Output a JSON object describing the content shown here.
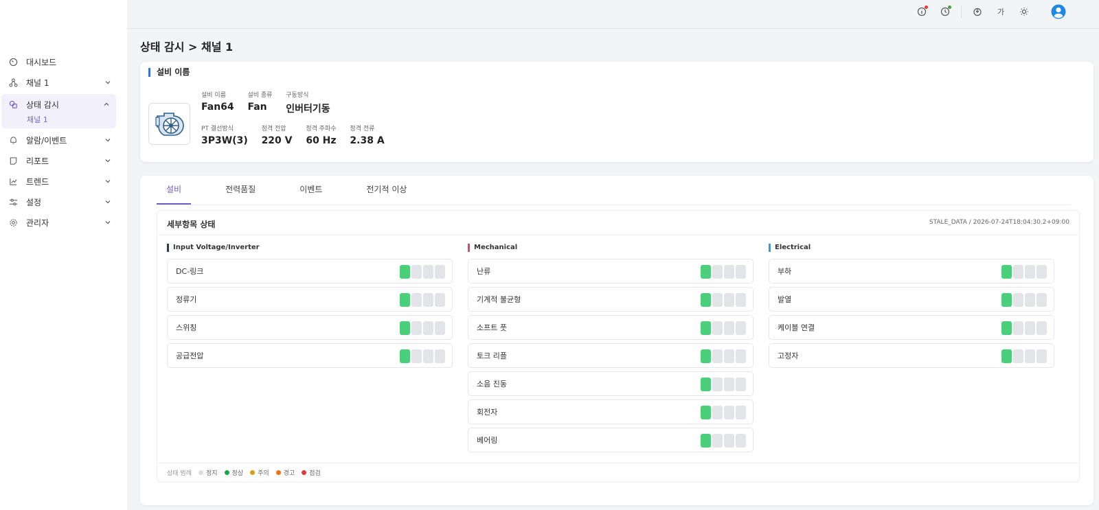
{
  "sidebar": {
    "items": [
      {
        "label": "대시보드",
        "icon": "gauge-icon",
        "chevron": false
      },
      {
        "label": "채널 1",
        "icon": "channel-icon",
        "chevron": true
      },
      {
        "label": "상태 감시",
        "icon": "monitor-icon",
        "chevron": true,
        "expanded": true,
        "sub": "채널 1"
      },
      {
        "label": "알람/이벤트",
        "icon": "bell-icon",
        "chevron": true
      },
      {
        "label": "리포트",
        "icon": "report-icon",
        "chevron": true
      },
      {
        "label": "트렌드",
        "icon": "trend-icon",
        "chevron": true
      },
      {
        "label": "설정",
        "icon": "sliders-icon",
        "chevron": true
      },
      {
        "label": "관리자",
        "icon": "gear-icon",
        "chevron": true
      }
    ]
  },
  "topbar": {
    "lang_label": "가",
    "icons": [
      "info-icon",
      "history-icon",
      "power-icon",
      "language-icon",
      "brightness-icon",
      "user-avatar-icon"
    ],
    "alert_dot_color": "#e53935",
    "ok_dot_color": "#43a047"
  },
  "page": {
    "title": "상태 감시 > 채널 1"
  },
  "equipment": {
    "heading": "설비 이름",
    "row1": [
      {
        "label": "설비 이름",
        "value": "Fan64"
      },
      {
        "label": "설비 종류",
        "value": "Fan"
      },
      {
        "label": "구동방식",
        "value": "인버터기동"
      }
    ],
    "row2": [
      {
        "label": "PT 결선방식",
        "value": "3P3W(3)"
      },
      {
        "label": "정격 전압",
        "value": "220 V"
      },
      {
        "label": "정격 주파수",
        "value": "60 Hz"
      },
      {
        "label": "정격 전류",
        "value": "2.38 A"
      }
    ]
  },
  "tabs": [
    "설비",
    "전력품질",
    "이벤트",
    "전기적 이상"
  ],
  "active_tab": 0,
  "status": {
    "title": "세부항목 상태",
    "meta": "STALE_DATA / 2026-07-24T18:04:30.2+09:00",
    "columns": [
      {
        "title": "Input Voltage/Inverter",
        "color": "#2b3a67",
        "items": [
          "DC-링크",
          "정류기",
          "스위칭",
          "공급전압"
        ]
      },
      {
        "title": "Mechanical",
        "color": "#d94a6a",
        "items": [
          "난류",
          "기계적 불균형",
          "소프트 풋",
          "토크 리플",
          "소음 진동",
          "회전자",
          "베어링"
        ]
      },
      {
        "title": "Electrical",
        "color": "#2aa4d8",
        "items": [
          "부하",
          "발열",
          "케이블 연결",
          "고정자"
        ]
      }
    ],
    "level": 1,
    "level_max": 4
  },
  "legend": {
    "title": "상태 범례",
    "entries": [
      {
        "label": "정지",
        "color": "#dcdcdc"
      },
      {
        "label": "정상",
        "color": "#1ea24a"
      },
      {
        "label": "주의",
        "color": "#d4a017"
      },
      {
        "label": "경고",
        "color": "#e8731a"
      },
      {
        "label": "점검",
        "color": "#e03a3a"
      }
    ]
  }
}
